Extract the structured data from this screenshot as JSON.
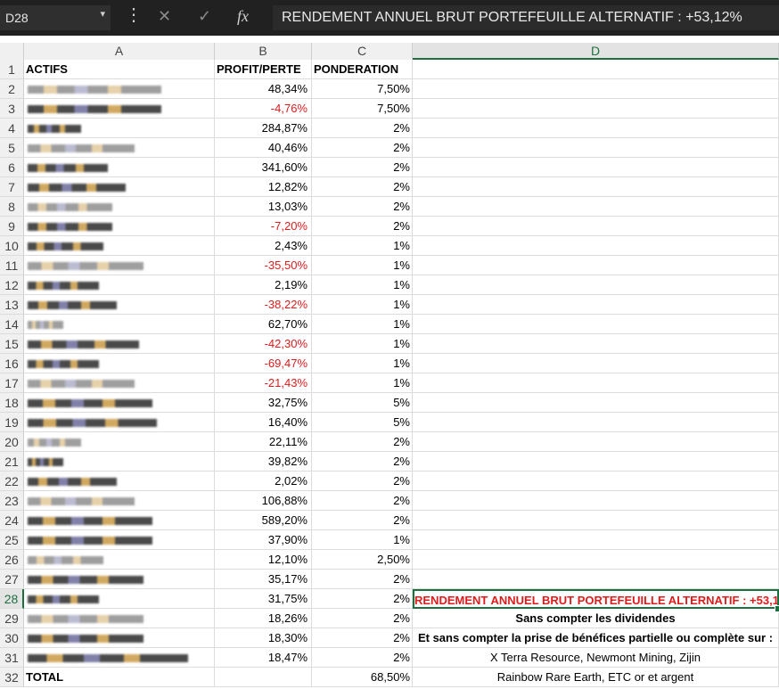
{
  "formula_bar": {
    "name_box": "D28",
    "cancel_glyph": "✕",
    "enter_glyph": "✓",
    "fx_glyph": "fx",
    "content": "RENDEMENT ANNUEL BRUT PORTEFEUILLE ALTERNATIF : +53,12%"
  },
  "columns": [
    "A",
    "B",
    "C",
    "D"
  ],
  "active_column": "D",
  "active_row": 28,
  "headers": {
    "a": "ACTIFS",
    "b": "PROFIT/PERTE",
    "c": "PONDERATION"
  },
  "rows": [
    {
      "n": "2",
      "b": "48,34%",
      "c": "7,50%",
      "neg": false
    },
    {
      "n": "3",
      "b": "-4,76%",
      "c": "7,50%",
      "neg": true
    },
    {
      "n": "4",
      "b": "284,87%",
      "c": "2%",
      "neg": false
    },
    {
      "n": "5",
      "b": "40,46%",
      "c": "2%",
      "neg": false
    },
    {
      "n": "6",
      "b": "341,60%",
      "c": "2%",
      "neg": false
    },
    {
      "n": "7",
      "b": "12,82%",
      "c": "2%",
      "neg": false
    },
    {
      "n": "8",
      "b": "13,03%",
      "c": "2%",
      "neg": false
    },
    {
      "n": "9",
      "b": "-7,20%",
      "c": "2%",
      "neg": true
    },
    {
      "n": "10",
      "b": "2,43%",
      "c": "1%",
      "neg": false
    },
    {
      "n": "11",
      "b": "-35,50%",
      "c": "1%",
      "neg": true
    },
    {
      "n": "12",
      "b": "2,19%",
      "c": "1%",
      "neg": false
    },
    {
      "n": "13",
      "b": "-38,22%",
      "c": "1%",
      "neg": true
    },
    {
      "n": "14",
      "b": "62,70%",
      "c": "1%",
      "neg": false
    },
    {
      "n": "15",
      "b": "-42,30%",
      "c": "1%",
      "neg": true
    },
    {
      "n": "16",
      "b": "-69,47%",
      "c": "1%",
      "neg": true
    },
    {
      "n": "17",
      "b": "-21,43%",
      "c": "1%",
      "neg": true
    },
    {
      "n": "18",
      "b": "32,75%",
      "c": "5%",
      "neg": false
    },
    {
      "n": "19",
      "b": "16,40%",
      "c": "5%",
      "neg": false
    },
    {
      "n": "20",
      "b": "22,11%",
      "c": "2%",
      "neg": false
    },
    {
      "n": "21",
      "b": "39,82%",
      "c": "2%",
      "neg": false
    },
    {
      "n": "22",
      "b": "2,02%",
      "c": "2%",
      "neg": false
    },
    {
      "n": "23",
      "b": "106,88%",
      "c": "2%",
      "neg": false
    },
    {
      "n": "24",
      "b": "589,20%",
      "c": "2%",
      "neg": false
    },
    {
      "n": "25",
      "b": "37,90%",
      "c": "1%",
      "neg": false
    },
    {
      "n": "26",
      "b": "12,10%",
      "c": "2,50%",
      "neg": false
    },
    {
      "n": "27",
      "b": "35,17%",
      "c": "2%",
      "neg": false
    },
    {
      "n": "28",
      "b": "31,75%",
      "c": "2%",
      "neg": false
    },
    {
      "n": "29",
      "b": "18,26%",
      "c": "2%",
      "neg": false
    },
    {
      "n": "30",
      "b": "18,30%",
      "c": "2%",
      "neg": false
    },
    {
      "n": "31",
      "b": "18,47%",
      "c": "2%",
      "neg": false
    }
  ],
  "d_notes": {
    "r28": "RENDEMENT ANNUEL BRUT PORTEFEUILLE ALTERNATIF : +53,12%",
    "r29": "Sans compter les dividendes",
    "r30": "Et sans compter la prise de bénéfices partielle ou complète sur :",
    "r31": "X Terra Resource, Newmont Mining, Zijin",
    "r32": "Rainbow Rare Earth, ETC or et argent"
  },
  "total": {
    "n": "32",
    "label": "TOTAL",
    "c": "68,50%"
  },
  "colors": {
    "negative": "#e01b1b",
    "selection": "#1e6f3f"
  }
}
